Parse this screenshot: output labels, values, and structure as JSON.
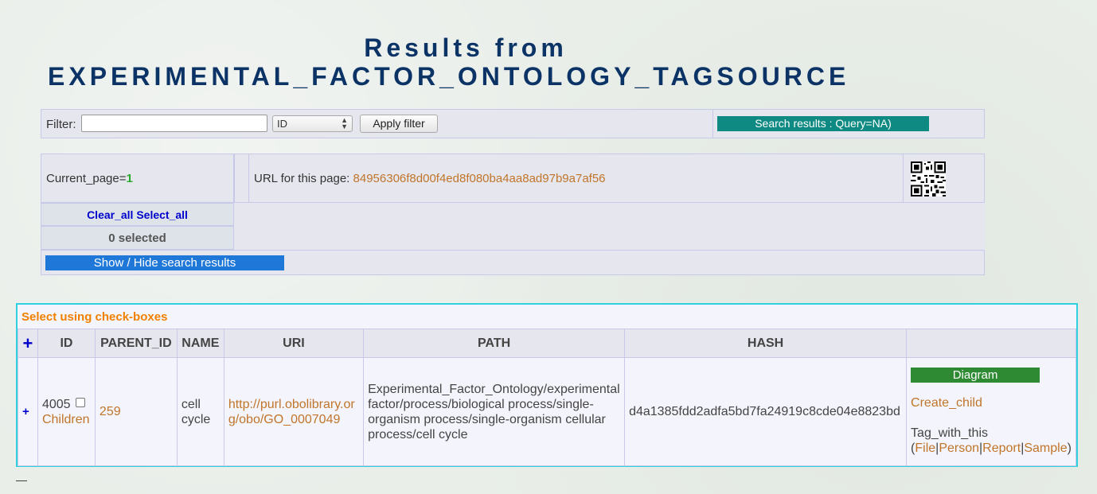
{
  "title": {
    "line1": "Results from",
    "line2": "EXPERIMENTAL_FACTOR_ONTOLOGY_TAGSOURCE"
  },
  "filter": {
    "label": "Filter:",
    "input_value": "",
    "select_value": "ID",
    "apply_label": "Apply filter",
    "search_results_label": "Search results : Query=NA)"
  },
  "paging": {
    "current_page_label": "Current_page=",
    "current_page": "1",
    "url_label": "URL for this page: ",
    "url_hash": "84956306f8d00f4ed8f080ba4aa8ad97b9a7af56",
    "clear_all": "Clear_all",
    "select_all": "Select_all",
    "selected_count": "0 selected",
    "show_hide_label": "Show / Hide search results"
  },
  "results": {
    "caption": "Select using check-boxes",
    "expand_all": "+",
    "columns": [
      "ID",
      "PARENT_ID",
      "NAME",
      "URI",
      "PATH",
      "HASH",
      ""
    ],
    "rows": [
      {
        "expand": "+",
        "id": "4005",
        "children": "Children",
        "parent_id": "259",
        "name": "cell cycle",
        "uri": "http://purl.obolibrary.org/obo/GO_0007049",
        "path": "Experimental_Factor_Ontology/experimental factor/process/biological process/single-organism process/single-organism cellular process/cell cycle",
        "hash": "d4a1385fdd2adfa5bd7fa24919c8cde04e8823bd",
        "actions": {
          "diagram": "Diagram",
          "create_child": "Create_child",
          "tag_with": "Tag_with_this",
          "open_paren": "(",
          "file": "File",
          "person": "Person",
          "report": "Report",
          "sample": "Sample",
          "sep": "|",
          "close_paren": ")"
        }
      }
    ]
  },
  "footer_dash": "—",
  "colors": {
    "title": "#0c3366",
    "search_results_btn": "#0f8a82",
    "show_hide_btn": "#1f78d8",
    "diagram_btn": "#2e8b34",
    "link": "#c0752a",
    "caption": "#f08000",
    "results_border": "#2fd0e0"
  }
}
